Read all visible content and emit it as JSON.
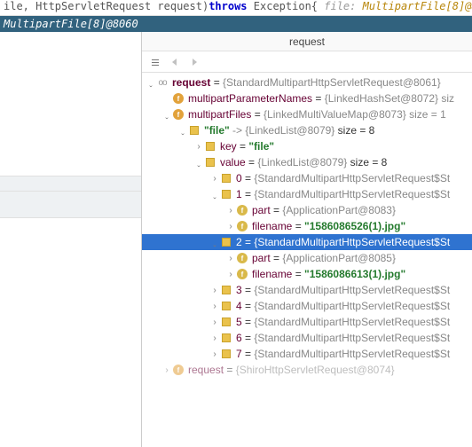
{
  "code_strip": {
    "prefix": "ile, HttpServletRequest request)",
    "throws": "throws",
    "exc": " Exception{   ",
    "comment_label": "file:",
    "comment_val": " MultipartFile[8]@80"
  },
  "call_strip": "MultipartFile[8]@8060",
  "panel_title": "request",
  "tree": {
    "request": {
      "name": "request",
      "eq": " = ",
      "val": "{StandardMultipartHttpServletRequest@8061}"
    },
    "mpn": {
      "name": "multipartParameterNames",
      "eq": " = ",
      "val": "{LinkedHashSet@8072}  siz"
    },
    "mf": {
      "name": "multipartFiles",
      "eq": " = ",
      "val": "{LinkedMultiValueMap@8073}  size = 1"
    },
    "file_entry": {
      "key": "\"file\"",
      "arrow": " -> ",
      "val": "{LinkedList@8079}",
      "size": "  size = 8"
    },
    "key_row": {
      "name": "key",
      "eq": " = ",
      "val": "\"file\""
    },
    "value_row": {
      "name": "value",
      "eq": " = ",
      "val": "{LinkedList@8079}",
      "size": "  size = 8"
    },
    "idx0": {
      "idx": "0",
      "eq": " = ",
      "val": "{StandardMultipartHttpServletRequest$St"
    },
    "idx1": {
      "idx": "1",
      "eq": " = ",
      "val": "{StandardMultipartHttpServletRequest$St"
    },
    "idx1_part": {
      "name": "part",
      "eq": " = ",
      "val": "{ApplicationPart@8083}"
    },
    "idx1_fn": {
      "name": "filename",
      "eq": " = ",
      "val": "\"1586086526(1).jpg\""
    },
    "idx2": {
      "idx": "2",
      "eq": " = ",
      "val": "{StandardMultipartHttpServletRequest$St"
    },
    "idx2_part": {
      "name": "part",
      "eq": " = ",
      "val": "{ApplicationPart@8085}"
    },
    "idx2_fn": {
      "name": "filename",
      "eq": " = ",
      "val": "\"1586086613(1).jpg\""
    },
    "idx3": {
      "idx": "3",
      "eq": " = ",
      "val": "{StandardMultipartHttpServletRequest$St"
    },
    "idx4": {
      "idx": "4",
      "eq": " = ",
      "val": "{StandardMultipartHttpServletRequest$St"
    },
    "idx5": {
      "idx": "5",
      "eq": " = ",
      "val": "{StandardMultipartHttpServletRequest$St"
    },
    "idx6": {
      "idx": "6",
      "eq": " = ",
      "val": "{StandardMultipartHttpServletRequest$St"
    },
    "idx7": {
      "idx": "7",
      "eq": " = ",
      "val": "{StandardMultipartHttpServletRequest$St"
    },
    "last": {
      "name": "request",
      "eq": " = ",
      "val": "{ShiroHttpServletRequest@8074}"
    }
  }
}
